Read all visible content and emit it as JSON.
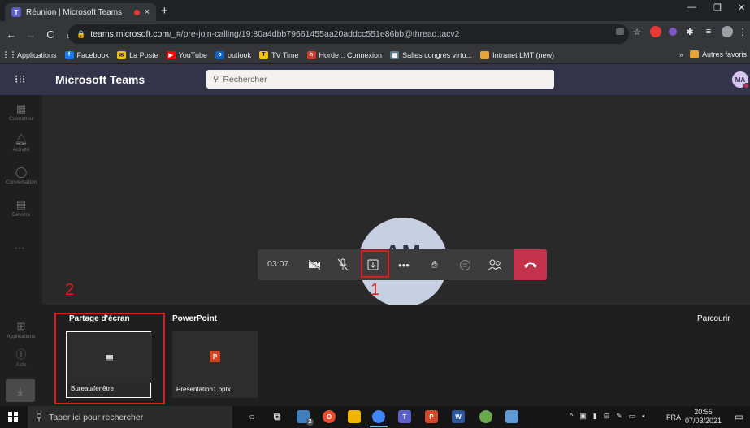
{
  "browser": {
    "tab_title": "Réunion | Microsoft Teams",
    "tab_close": "×",
    "new_tab": "+",
    "url_host": "teams.microsoft.com",
    "url_path": "/_#/pre-join-calling/19:80a4dbb79661455aa20addcc551e86bb@thread.tacv2",
    "bookmarks": [
      "Applications",
      "Facebook",
      "La Poste",
      "YouTube",
      "outlook",
      "TV Time",
      "Horde :: Connexion",
      "Salles congrès virtu...",
      "Intranet LMT (new)"
    ],
    "bookmarks_more": "»",
    "other_bookmarks": "Autres favoris"
  },
  "teams": {
    "brand": "Microsoft Teams",
    "search_placeholder": "Rechercher",
    "user_initials": "MA",
    "rail": [
      "Calendrier",
      "Activité",
      "Conversation",
      "Devoirs"
    ],
    "rail_more": "...",
    "rail_bottom": [
      "Applications",
      "Aide"
    ],
    "participant_initials": "AM"
  },
  "call": {
    "timer": "03:07"
  },
  "share": {
    "screen_header": "Partage d'écran",
    "powerpoint_header": "PowerPoint",
    "browse": "Parcourir",
    "screen_item": "Bureau/fenêtre",
    "ppt_item": "Présentation1.pptx"
  },
  "annotations": {
    "num1": "1",
    "num2": "2"
  },
  "taskbar": {
    "search_placeholder": "Taper ici pour rechercher",
    "badge": "2",
    "lang": "FRA",
    "time": "20:55",
    "date": "07/03/2021"
  },
  "colors": {
    "teams_header": "#33344a",
    "hangup": "#c4314b",
    "annotation": "#e01b1b"
  }
}
